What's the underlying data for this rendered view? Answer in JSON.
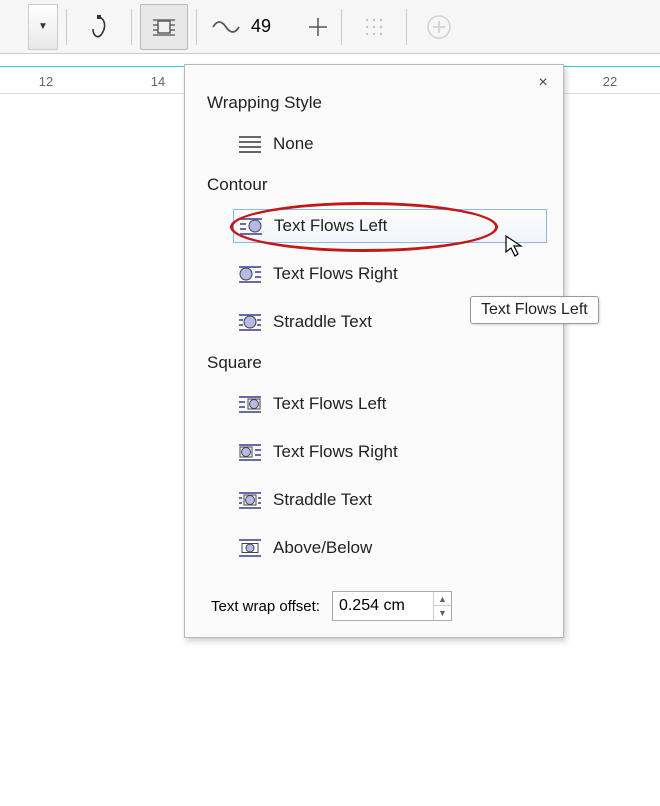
{
  "toolbar": {
    "spin_value": "49"
  },
  "ruler": {
    "ticks": [
      12,
      14,
      22
    ]
  },
  "panel": {
    "close_glyph": "×",
    "wrapping_style_header": "Wrapping Style",
    "none_label": "None",
    "contour_header": "Contour",
    "contour_flows_left": "Text Flows Left",
    "contour_flows_right": "Text Flows Right",
    "contour_straddle": "Straddle Text",
    "square_header": "Square",
    "square_flows_left": "Text Flows Left",
    "square_flows_right": "Text Flows Right",
    "square_straddle": "Straddle Text",
    "square_above_below": "Above/Below",
    "offset_label": "Text wrap offset:",
    "offset_value": "0.254 cm"
  },
  "tooltip": {
    "text": "Text Flows Left"
  }
}
